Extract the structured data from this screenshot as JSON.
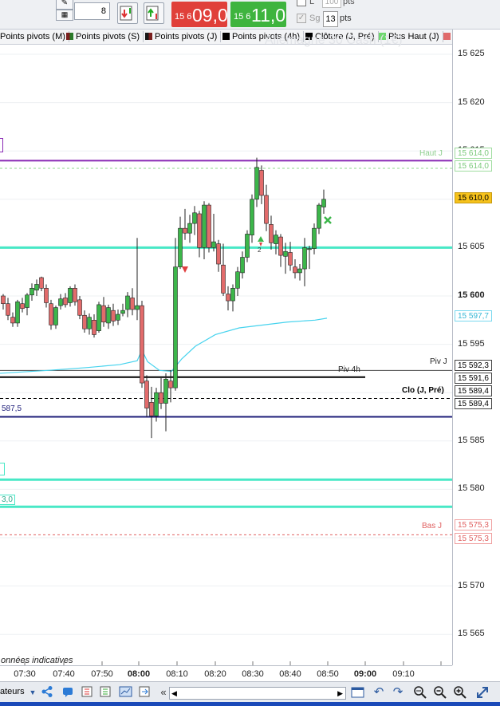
{
  "toolbar": {
    "quantity": "8",
    "sell_prefix": "15 6",
    "sell_price": "09,0",
    "buy_prefix": "15 6",
    "buy_price": "11,0",
    "limit_label": "L",
    "limit_value": "100",
    "limit_unit": "pts",
    "stop_label": "Sg",
    "stop_value": "13",
    "stop_unit": "pts"
  },
  "chart": {
    "watermark": "Allemagne 30 Cash (1€)",
    "disclaimer": "onnées indicatives",
    "legend": [
      {
        "label": "Points pivots (M)",
        "color": "#3a6d3a"
      },
      {
        "label": "Points pivots (S)",
        "color": "#7a1f1f"
      },
      {
        "label": "Points pivots (J)",
        "color": "#1a1a1a"
      },
      {
        "label": "Points pivots (4h)",
        "color": "#000000"
      },
      {
        "label": "Clôture (J, Pré)",
        "color": "#000000"
      },
      {
        "label": "Plus Haut (J)",
        "color": "#6fd86f"
      }
    ],
    "line_labels": {
      "haut_j": "Haut J",
      "piv_j": "Piv J",
      "piv_4h": "Piv 4h",
      "clo_j_pre": "Clo (J, Pré)",
      "bas_j": "Bas J",
      "left_587": "587,5",
      "left_box": "3,0"
    },
    "y_ticks": [
      "15 625",
      "15 620",
      "15 615",
      "15 610",
      "15 605",
      "15 600",
      "15 595",
      "15 590",
      "15 585",
      "15 580",
      "15 575",
      "15 570",
      "15 565"
    ],
    "x_ticks": [
      "07:30",
      "07:40",
      "07:50",
      "08:00",
      "08:10",
      "08:20",
      "08:30",
      "08:40",
      "08:50",
      "09:00",
      "09:10"
    ],
    "price_tags": {
      "haut_j_top": "15 614,0",
      "haut_j": "15 614,0",
      "last": "15 610,0",
      "ma": "15 597,7",
      "piv_j": "15 592,3",
      "piv_4h": "15 591,6",
      "clo1": "15 589,4",
      "clo2": "15 589,4",
      "bas1": "15 575,3",
      "bas2": "15 575,3"
    },
    "colors": {
      "up": "#3cb64a",
      "down": "#e26b6b",
      "cyan": "#48e8c6",
      "purple": "#8a2bb5",
      "navy": "#1e1e7a",
      "ma": "#46d3ee"
    }
  },
  "bottombar": {
    "left_label": "ateurs"
  }
}
